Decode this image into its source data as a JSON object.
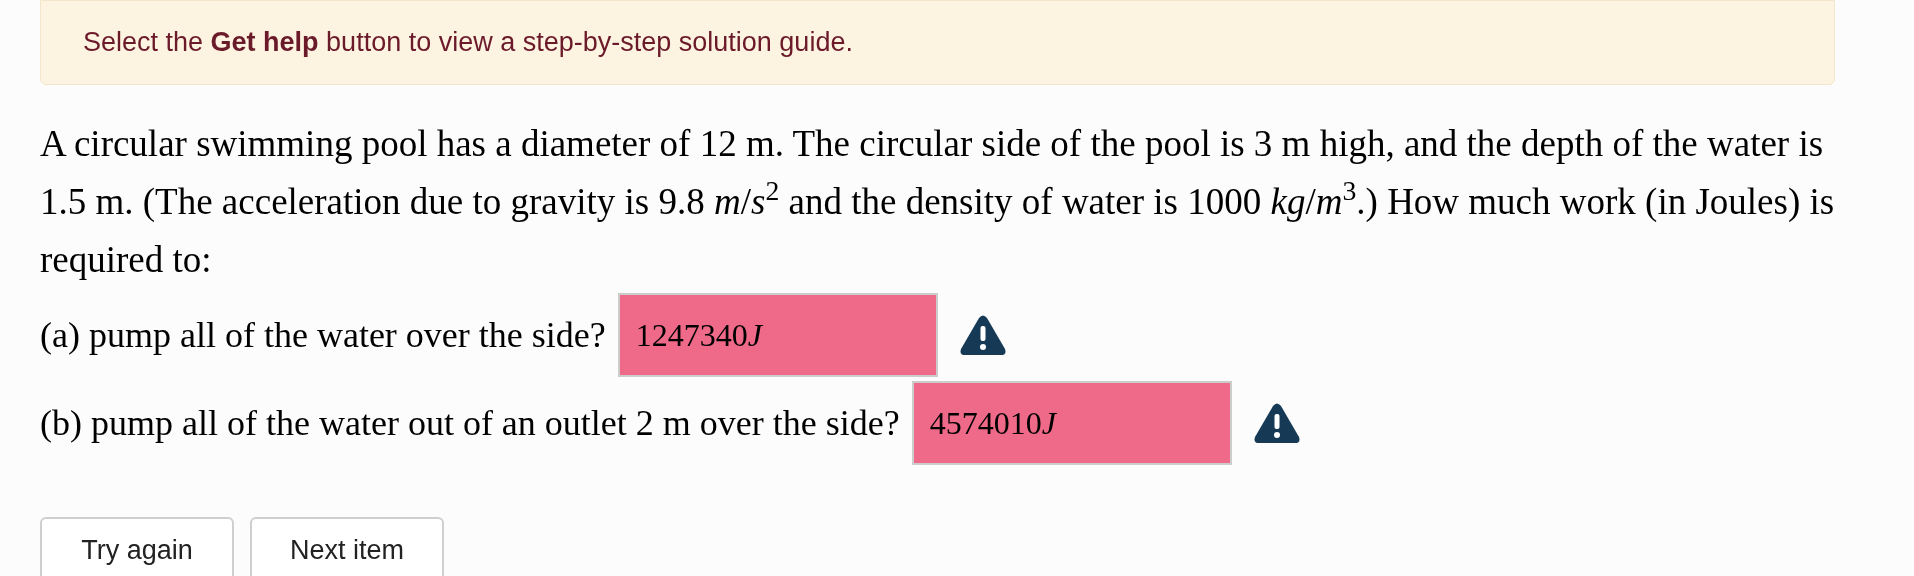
{
  "hint_banner": {
    "text": "Select the **Get help** button to view a step-by-step solution guide."
  },
  "question": {
    "text": "A circular swimming pool has a diameter of 12 m. The circular side of the pool is 3 m high, and the depth of the water is 1.5 m. (The acceleration due to gravity is 9.8 *m*/*s*$^{2}$ and the density of water is 1000 *kg*/*m*$^{3}$.) How much work (in Joules) is required to:"
  },
  "parts": [
    {
      "prompt": "(a) pump all of the water over the side?",
      "answer": "1247340",
      "unit": "J",
      "correct": false
    },
    {
      "prompt": "(b) pump all of the water out of an outlet 2 m over the side?",
      "answer": "4574010",
      "unit": "J",
      "correct": false
    }
  ],
  "buttons": [
    "Try again",
    "Next item"
  ]
}
